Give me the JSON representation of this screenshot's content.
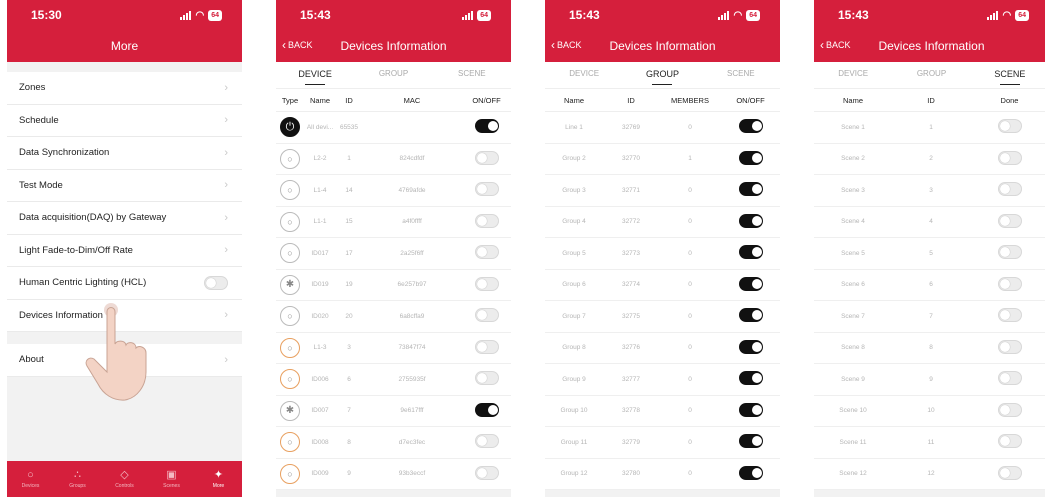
{
  "panel1": {
    "time": "15:30",
    "battery": "64",
    "title": "More",
    "items": [
      {
        "label": "Zones"
      },
      {
        "label": "Schedule"
      },
      {
        "label": "Data Synchronization"
      },
      {
        "label": "Test Mode"
      },
      {
        "label": "Data acquisition(DAQ) by Gateway"
      },
      {
        "label": "Light Fade-to-Dim/Off Rate"
      },
      {
        "label": "Human Centric Lighting (HCL)"
      },
      {
        "label": "Devices Information"
      }
    ],
    "about": "About",
    "tabbar": [
      "Devices",
      "Groups",
      "Controls",
      "Scenes",
      "More"
    ]
  },
  "panel2": {
    "time": "15:43",
    "battery": "64",
    "back": "BACK",
    "title": "Devices Information",
    "tabs": [
      "DEVICE",
      "GROUP",
      "SCENE"
    ],
    "columns": [
      "Type",
      "Name",
      "ID",
      "MAC",
      "ON/OFF"
    ],
    "rows": [
      {
        "icon": "power-icon",
        "name": "All devi...",
        "id": "65535",
        "mac": "",
        "on": true
      },
      {
        "icon": "bulb-icon",
        "name": "L2-2",
        "id": "1",
        "mac": "824cdfdf",
        "on": false
      },
      {
        "icon": "bulb-icon",
        "name": "L1-4",
        "id": "14",
        "mac": "4769afde",
        "on": false
      },
      {
        "icon": "bulb-icon",
        "name": "L1-1",
        "id": "15",
        "mac": "a4f0ffff",
        "on": false
      },
      {
        "icon": "bulb-icon",
        "name": "ID017",
        "id": "17",
        "mac": "2a25f6ff",
        "on": false
      },
      {
        "icon": "bluetooth-icon",
        "name": "ID019",
        "id": "19",
        "mac": "6e257b97",
        "on": false
      },
      {
        "icon": "bulb-icon",
        "name": "ID020",
        "id": "20",
        "mac": "6a8cffa9",
        "on": false
      },
      {
        "icon": "bulb-orange-icon",
        "name": "L1-3",
        "id": "3",
        "mac": "73847f74",
        "on": false
      },
      {
        "icon": "bulb-orange-icon",
        "name": "ID006",
        "id": "6",
        "mac": "2755935f",
        "on": false
      },
      {
        "icon": "bluetooth-icon",
        "name": "ID007",
        "id": "7",
        "mac": "9e617fff",
        "on": true
      },
      {
        "icon": "bulb-orange-icon",
        "name": "ID008",
        "id": "8",
        "mac": "d7ec3fec",
        "on": false
      },
      {
        "icon": "bulb-orange-icon",
        "name": "ID009",
        "id": "9",
        "mac": "93b3eccf",
        "on": false
      }
    ]
  },
  "panel3": {
    "time": "15:43",
    "battery": "64",
    "back": "BACK",
    "title": "Devices Information",
    "tabs": [
      "DEVICE",
      "GROUP",
      "SCENE"
    ],
    "columns": [
      "Name",
      "ID",
      "MEMBERS",
      "ON/OFF"
    ],
    "rows": [
      {
        "name": "Line 1",
        "id": "32769",
        "members": "0",
        "on": true
      },
      {
        "name": "Group 2",
        "id": "32770",
        "members": "1",
        "on": true
      },
      {
        "name": "Group 3",
        "id": "32771",
        "members": "0",
        "on": true
      },
      {
        "name": "Group 4",
        "id": "32772",
        "members": "0",
        "on": true
      },
      {
        "name": "Group 5",
        "id": "32773",
        "members": "0",
        "on": true
      },
      {
        "name": "Group 6",
        "id": "32774",
        "members": "0",
        "on": true
      },
      {
        "name": "Group 7",
        "id": "32775",
        "members": "0",
        "on": true
      },
      {
        "name": "Group 8",
        "id": "32776",
        "members": "0",
        "on": true
      },
      {
        "name": "Group 9",
        "id": "32777",
        "members": "0",
        "on": true
      },
      {
        "name": "Group 10",
        "id": "32778",
        "members": "0",
        "on": true
      },
      {
        "name": "Group 11",
        "id": "32779",
        "members": "0",
        "on": true
      },
      {
        "name": "Group 12",
        "id": "32780",
        "members": "0",
        "on": true
      }
    ]
  },
  "panel4": {
    "time": "15:43",
    "battery": "64",
    "back": "BACK",
    "title": "Devices Information",
    "tabs": [
      "DEVICE",
      "GROUP",
      "SCENE"
    ],
    "columns": [
      "Name",
      "ID",
      "Done"
    ],
    "rows": [
      {
        "name": "Scene 1",
        "id": "1",
        "on": false
      },
      {
        "name": "Scene 2",
        "id": "2",
        "on": false
      },
      {
        "name": "Scene 3",
        "id": "3",
        "on": false
      },
      {
        "name": "Scene 4",
        "id": "4",
        "on": false
      },
      {
        "name": "Scene 5",
        "id": "5",
        "on": false
      },
      {
        "name": "Scene 6",
        "id": "6",
        "on": false
      },
      {
        "name": "Scene 7",
        "id": "7",
        "on": false
      },
      {
        "name": "Scene 8",
        "id": "8",
        "on": false
      },
      {
        "name": "Scene 9",
        "id": "9",
        "on": false
      },
      {
        "name": "Scene 10",
        "id": "10",
        "on": false
      },
      {
        "name": "Scene 11",
        "id": "11",
        "on": false
      },
      {
        "name": "Scene 12",
        "id": "12",
        "on": false
      }
    ]
  },
  "colors": {
    "brand": "#d51f3c",
    "toggle_on": "#111111",
    "toggle_off": "#ececec"
  }
}
